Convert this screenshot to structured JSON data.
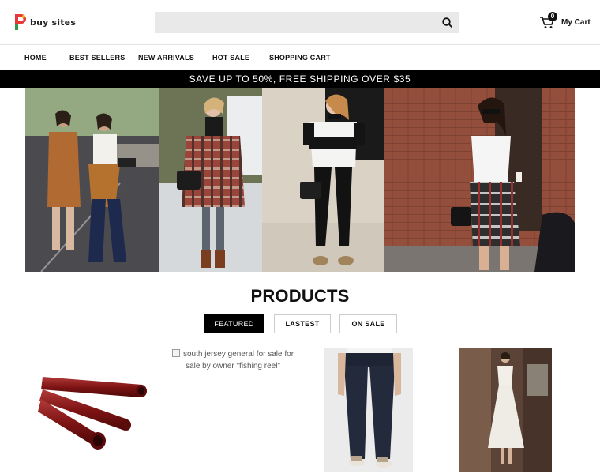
{
  "brand": {
    "name": "buy sites",
    "logo_letter": "P"
  },
  "search": {
    "value": "",
    "placeholder": ""
  },
  "cart": {
    "count": "0",
    "label": "My Cart"
  },
  "nav": {
    "items": [
      {
        "label": "HOME"
      },
      {
        "label": "BEST SELLERS"
      },
      {
        "label": "NEW ARRIVALS"
      },
      {
        "label": "HOT SALE"
      },
      {
        "label": "SHOPPING CART"
      }
    ]
  },
  "promo": {
    "text": "SAVE UP TO 50%, FREE SHIPPING OVER $35"
  },
  "products": {
    "title": "PRODUCTS",
    "tabs": [
      {
        "label": "FEATURED",
        "active": true
      },
      {
        "label": "LASTEST",
        "active": false
      },
      {
        "label": "ON SALE",
        "active": false
      }
    ],
    "broken_image_alt": "south jersey general for sale for sale by owner \"fishing reel\""
  },
  "colors": {
    "accent": "#000000",
    "promo_bg": "#000000",
    "search_bg": "#e9e9e9",
    "logo_red": "#e53935",
    "logo_green": "#2e9b45"
  }
}
